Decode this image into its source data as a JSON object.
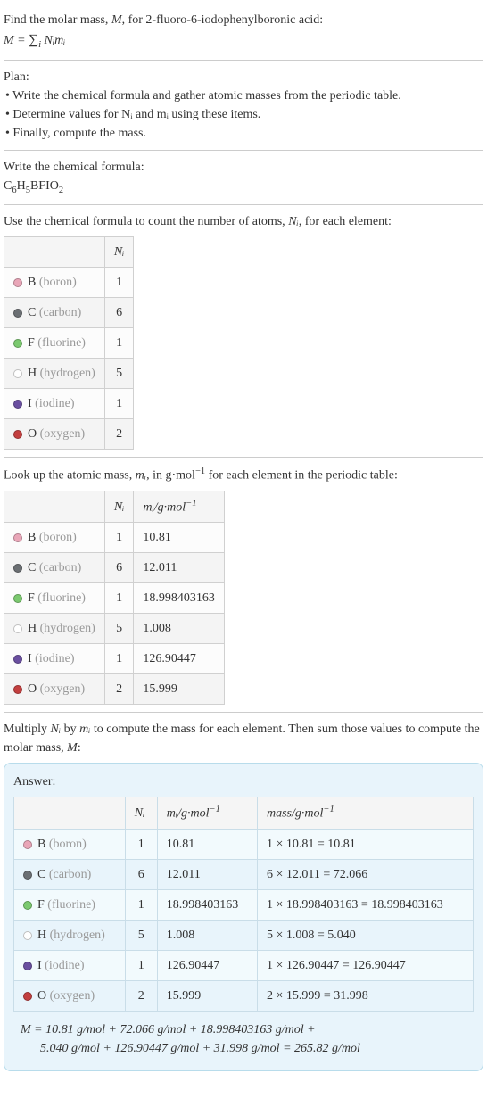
{
  "intro": {
    "line1_prefix": "Find the molar mass, ",
    "line1_var": "M",
    "line1_suffix": ", for 2-fluoro-6-iodophenylboronic acid:",
    "equation_left": "M = ",
    "equation_sum": "∑",
    "equation_sub": "i",
    "equation_right": " Nᵢmᵢ"
  },
  "plan": {
    "title": "Plan:",
    "items": [
      "Write the chemical formula and gather atomic masses from the periodic table.",
      "Determine values for Nᵢ and mᵢ using these items.",
      "Finally, compute the mass."
    ]
  },
  "write_formula": {
    "title": "Write the chemical formula:",
    "formula_parts": [
      "C",
      "6",
      "H",
      "5",
      "BFIO",
      "2"
    ]
  },
  "count_atoms": {
    "intro_a": "Use the chemical formula to count the number of atoms, ",
    "intro_var": "Nᵢ",
    "intro_b": ", for each element:",
    "header": "Nᵢ",
    "rows": [
      {
        "dot": "#e9a6b8",
        "sym": "B",
        "name": "(boron)",
        "n": "1"
      },
      {
        "dot": "#6b6f73",
        "sym": "C",
        "name": "(carbon)",
        "n": "6"
      },
      {
        "dot": "#7bc96f",
        "sym": "F",
        "name": "(fluorine)",
        "n": "1"
      },
      {
        "dot": "#ffffff",
        "sym": "H",
        "name": "(hydrogen)",
        "n": "5"
      },
      {
        "dot": "#6a4fa0",
        "sym": "I",
        "name": "(iodine)",
        "n": "1"
      },
      {
        "dot": "#c33f3f",
        "sym": "O",
        "name": "(oxygen)",
        "n": "2"
      }
    ]
  },
  "atomic_mass": {
    "intro_a": "Look up the atomic mass, ",
    "intro_var": "mᵢ",
    "intro_b": ", in g·mol",
    "intro_exp": "−1",
    "intro_c": " for each element in the periodic table:",
    "header_n": "Nᵢ",
    "header_m_prefix": "mᵢ/g·mol",
    "header_m_exp": "−1",
    "rows": [
      {
        "dot": "#e9a6b8",
        "sym": "B",
        "name": "(boron)",
        "n": "1",
        "m": "10.81"
      },
      {
        "dot": "#6b6f73",
        "sym": "C",
        "name": "(carbon)",
        "n": "6",
        "m": "12.011"
      },
      {
        "dot": "#7bc96f",
        "sym": "F",
        "name": "(fluorine)",
        "n": "1",
        "m": "18.998403163"
      },
      {
        "dot": "#ffffff",
        "sym": "H",
        "name": "(hydrogen)",
        "n": "5",
        "m": "1.008"
      },
      {
        "dot": "#6a4fa0",
        "sym": "I",
        "name": "(iodine)",
        "n": "1",
        "m": "126.90447"
      },
      {
        "dot": "#c33f3f",
        "sym": "O",
        "name": "(oxygen)",
        "n": "2",
        "m": "15.999"
      }
    ]
  },
  "compute": {
    "intro_a": "Multiply ",
    "intro_n": "Nᵢ",
    "intro_b": " by ",
    "intro_m": "mᵢ",
    "intro_c": " to compute the mass for each element. Then sum those values to compute the molar mass, ",
    "intro_M": "M",
    "intro_d": ":"
  },
  "answer": {
    "label": "Answer:",
    "header_n": "Nᵢ",
    "header_m_prefix": "mᵢ/g·mol",
    "header_m_exp": "−1",
    "header_mass_prefix": "mass/g·mol",
    "header_mass_exp": "−1",
    "rows": [
      {
        "dot": "#e9a6b8",
        "sym": "B",
        "name": "(boron)",
        "n": "1",
        "m": "10.81",
        "mass": "1 × 10.81 = 10.81"
      },
      {
        "dot": "#6b6f73",
        "sym": "C",
        "name": "(carbon)",
        "n": "6",
        "m": "12.011",
        "mass": "6 × 12.011 = 72.066"
      },
      {
        "dot": "#7bc96f",
        "sym": "F",
        "name": "(fluorine)",
        "n": "1",
        "m": "18.998403163",
        "mass": "1 × 18.998403163 = 18.998403163"
      },
      {
        "dot": "#ffffff",
        "sym": "H",
        "name": "(hydrogen)",
        "n": "5",
        "m": "1.008",
        "mass": "5 × 1.008 = 5.040"
      },
      {
        "dot": "#6a4fa0",
        "sym": "I",
        "name": "(iodine)",
        "n": "1",
        "m": "126.90447",
        "mass": "1 × 126.90447 = 126.90447"
      },
      {
        "dot": "#c33f3f",
        "sym": "O",
        "name": "(oxygen)",
        "n": "2",
        "m": "15.999",
        "mass": "2 × 15.999 = 31.998"
      }
    ],
    "final_line1": "M = 10.81 g/mol + 72.066 g/mol + 18.998403163 g/mol +",
    "final_line2": "5.040 g/mol + 126.90447 g/mol + 31.998 g/mol = 265.82 g/mol"
  }
}
